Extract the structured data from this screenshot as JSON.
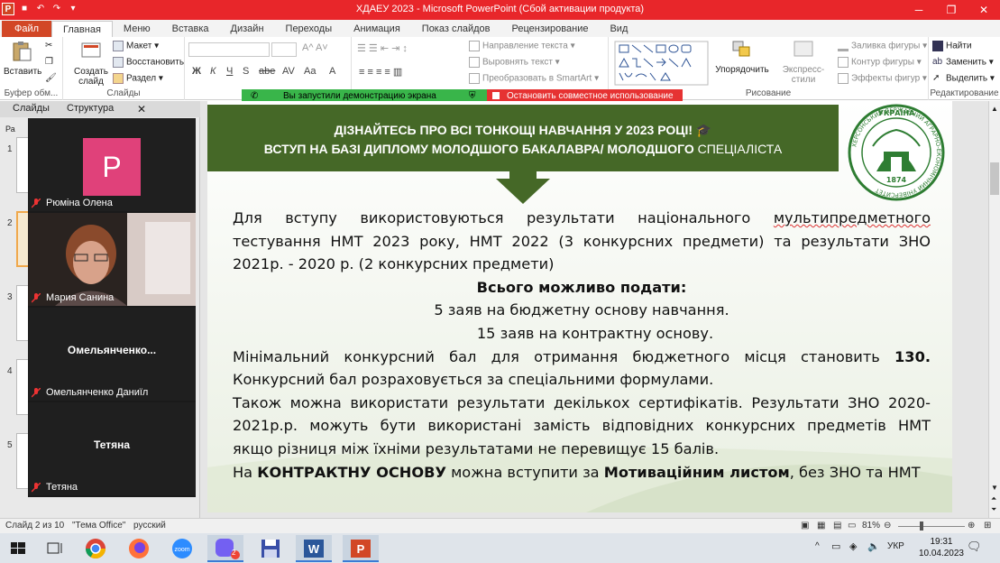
{
  "window": {
    "title": "ХДАЕУ 2023  -  Microsoft PowerPoint (Сбой активации продукта)",
    "app_icon": "powerpoint-icon"
  },
  "ribbon": {
    "tabs": [
      "Файл",
      "Главная",
      "Меню",
      "Вставка",
      "Дизайн",
      "Переходы",
      "Анимация",
      "Показ слайдов",
      "Рецензирование",
      "Вид"
    ],
    "active_tab": "Главная",
    "clipboard": {
      "paste": "Вставить",
      "label": "Буфер обм..."
    },
    "slides": {
      "create": "Создать слайд",
      "create_l1": "Создать",
      "create_l2": "слайд",
      "layout": "Макет",
      "reset": "Восстановить",
      "section": "Раздел",
      "label": "Слайды"
    },
    "paragraph": {
      "text_dir": "Направление текста",
      "align_text": "Выровнять текст",
      "smartart": "Преобразовать в SmartArt"
    },
    "drawing": {
      "arrange": "Упорядочить",
      "quick_styles": "Экспресс-стили",
      "fill": "Заливка фигуры",
      "outline": "Контур фигуры",
      "effects": "Эффекты фигур",
      "label": "Рисование"
    },
    "editing": {
      "find": "Найти",
      "replace": "Заменить",
      "select": "Выделить",
      "label": "Редактирование"
    }
  },
  "notifications": {
    "share_started": "Вы запустили демонстрацию экрана",
    "stop_share": "Остановить совместное использование"
  },
  "left_panel": {
    "tabs": [
      "Слайды",
      "Структура"
    ],
    "slide_numbers": [
      "1",
      "2",
      "3",
      "4",
      "5"
    ],
    "outline_hint": "Ра"
  },
  "zoom": {
    "participants": [
      {
        "name": "Рюміна Олена",
        "initial": "P",
        "type": "avatar"
      },
      {
        "name": "Мария Санина",
        "type": "video"
      },
      {
        "name": "Омельянченко Даниїл",
        "display": "Омельянченко...",
        "type": "name"
      },
      {
        "name": "Тетяна",
        "display": "Тетяна",
        "type": "name"
      }
    ]
  },
  "slide": {
    "banner_line1": "ДІЗНАЙТЕСЬ ПРО ВСІ ТОНКОЩІ НАВЧАННЯ У 2023 РОЦІ! 🎓",
    "banner_line2_bold": "ВСТУП НА БАЗІ ДИПЛОМУ МОЛОДШОГО БАКАЛАВРА/  МОЛОДШОГО",
    "banner_line2_thin": " СПЕЦІАЛІСТА",
    "logo_country": "УКРАЇНА",
    "logo_ring": "ХЕРСОНСЬКИЙ ДЕРЖАВНИЙ АГРАРНО-ЕКОНОМІЧНИЙ УНІВЕРСИТЕТ",
    "logo_year": "1874",
    "p1_a": "Для вступу використовуються результати національного",
    "p1_u": "мультипредметного",
    "p1_b": "тестування НМТ 2023 року, НМТ 2022 (3 конкурсних предмети) та результати ЗНО",
    "p1_c": "2021р. - 2020 р. (2 конкурсних предмети)",
    "p2_title": "Всього можливо подати:",
    "p2_l1": "5 заяв на бюджетну основу навчання.",
    "p2_l2": "15 заяв на  контрактну основу.",
    "p3_a": "  Мінімальний конкурсний бал для отримання бюджетного місця становить ",
    "p3_bold": "130.",
    "p3_b": "Конкурсний бал розраховується за спеціальними формулами.",
    "p4_a": "Також можна використати результати декількох сертифікатів. Результати ЗНО 2020-",
    "p4_b": "2021р.р.  можуть бути використані замість відповідних конкурсних предметів НМТ",
    "p4_c": "якщо різниця між їхніми результатами не перевищує 15 балів.",
    "p5_a": "На ",
    "p5_bold1": "КОНТРАКТНУ ОСНОВУ",
    "p5_b": " можна вступити за ",
    "p5_bold2": "Мотиваційним листом",
    "p5_c": ", без ЗНО та НМТ"
  },
  "statusbar": {
    "slide_info": "Слайд 2 из 10",
    "theme": "\"Тема Office\"",
    "language": "русский",
    "zoom": "81%"
  },
  "taskbar": {
    "apps": [
      "windows-start-icon",
      "task-view-icon",
      "chrome-icon",
      "firefox-icon",
      "zoom-icon",
      "viber-icon",
      "save-icon",
      "word-icon",
      "powerpoint-icon"
    ],
    "viber_badge": "2",
    "language": "УКР",
    "time": "19:31",
    "date": "10.04.2023"
  },
  "colors": {
    "titlebar": "#e8262a",
    "banner": "#456827",
    "share_green": "#39b54a",
    "share_red": "#e63232",
    "avatar": "#e0417a"
  }
}
